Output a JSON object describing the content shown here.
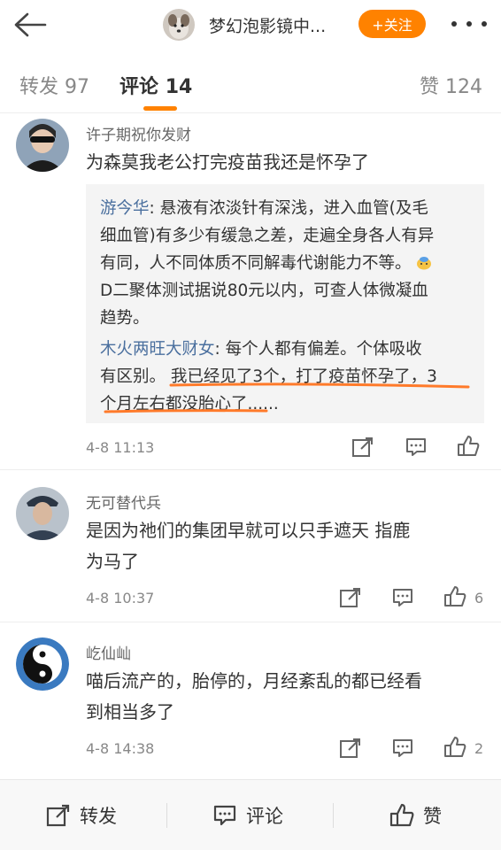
{
  "header": {
    "back_icon": "back-arrow-icon",
    "title": "梦幻泡影镜中...",
    "follow_label": "+关注",
    "follow_color": "#ff8200",
    "more_icon": "more-dots-icon"
  },
  "tabs": [
    {
      "label": "转发",
      "count": "97"
    },
    {
      "label": "评论",
      "count": "14",
      "active": true
    },
    {
      "label": "赞",
      "count": "124"
    }
  ],
  "comments": [
    {
      "user": "许子期祝你发财",
      "text": "为森莫我老公打完疫苗我还是怀孕了",
      "replies": [
        {
          "user": "游今华",
          "lines": [
            "悬液有浓淡针有深浅，进入血管(及毛",
            "细血管)有多少有缓急之差，走遍全身各人有异",
            "有同，人不同体质不同解毒代谢能力不等。",
            "D二聚体测试据说80元以内，可查人体微凝血",
            "趋势。"
          ]
        },
        {
          "user": "木火两旺大财女",
          "lines": [
            "每个人都有偏差。个体吸收",
            "有区别。",
            "我已经见了3个，打了疫苗怀孕了，3",
            "个月左右都没胎心了......"
          ]
        }
      ],
      "time": "4-8 11:13",
      "likes": ""
    },
    {
      "user": "无可替代兵",
      "text_lines": [
        "是因为祂们的集团早就可以只手遮天  指鹿",
        "为马了"
      ],
      "time": "4-8 10:37",
      "likes": "6"
    },
    {
      "user": "屹仙屾",
      "text_lines": [
        "喵后流产的，胎停的，月经紊乱的都已经看",
        "到相当多了"
      ],
      "time": "4-8 14:38",
      "likes": "2"
    }
  ],
  "bottom": {
    "repost_label": "转发",
    "comment_label": "评论",
    "like_label": "赞"
  },
  "colors": {
    "accent": "#ff8200",
    "link": "#4a6f9e",
    "underline": "#ff7a2a"
  }
}
